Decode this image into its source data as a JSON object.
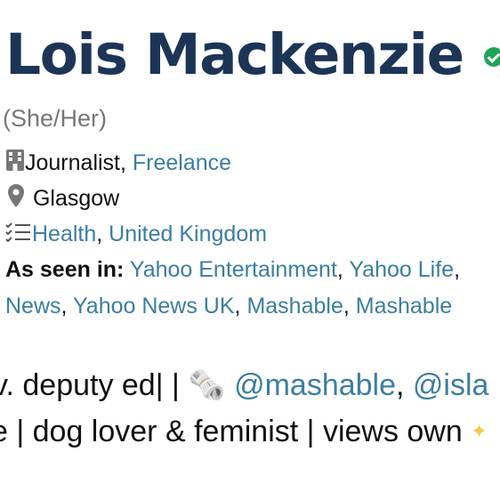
{
  "profile": {
    "name": "Lois Mackenzie",
    "pronouns": "(She/Her)",
    "job": {
      "role": "Journalist",
      "separator": ", ",
      "employer": "Freelance"
    },
    "location": "Glasgow",
    "topics": [
      {
        "label": "Health"
      },
      {
        "label": "United Kingdom"
      }
    ],
    "seen_in": {
      "label": "As seen in:",
      "row1": [
        "Yahoo Entertainment",
        "Yahoo Life"
      ],
      "row2": [
        "News",
        "Yahoo News UK",
        "Mashable",
        "Mashable"
      ]
    },
    "bio": {
      "line1_text": "v. deputy ed| | ",
      "line1_emoji": "🗞️",
      "line1_handles": [
        "@mashable",
        "@isla"
      ],
      "line2_text": "e | dog lover & feminist | views own "
    }
  },
  "colors": {
    "name": "#1c3557",
    "link": "#3b7ea1",
    "verified": "#22a35a",
    "pronouns": "#777777",
    "sparkle": "#f2c94c"
  },
  "icons": [
    "verified-check-icon",
    "building-icon",
    "location-pin-icon",
    "topics-list-icon",
    "sparkle-icon"
  ]
}
